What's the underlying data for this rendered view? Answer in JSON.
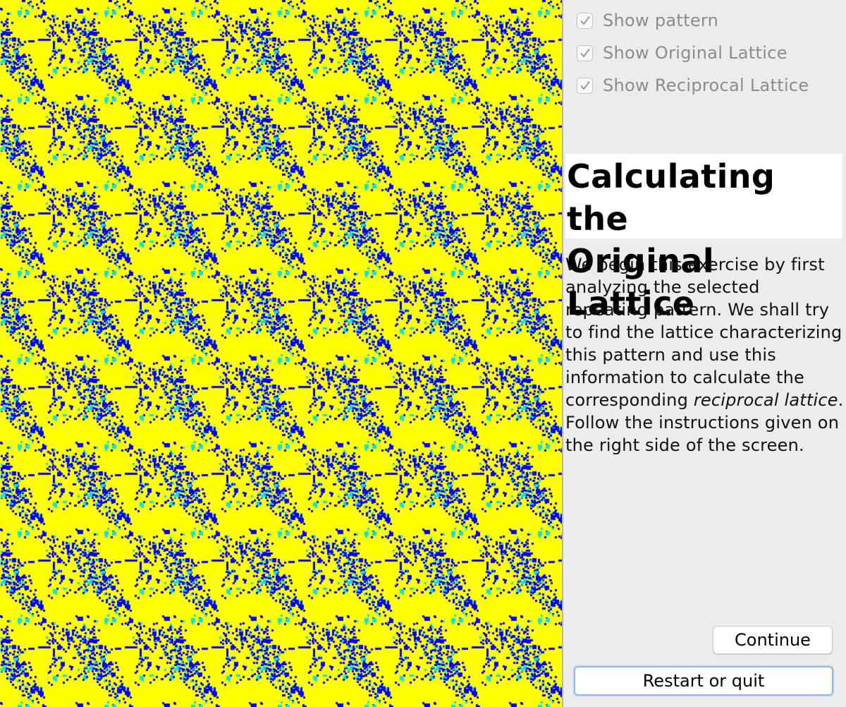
{
  "pattern": {
    "background_color": "#ffff00",
    "primary_dot_color": "#0000ff",
    "secondary_dot_color": "#00e5e5"
  },
  "options": [
    {
      "label": "Show pattern",
      "checked": true
    },
    {
      "label": "Show Original Lattice",
      "checked": true
    },
    {
      "label": "Show Reciprocal Lattice",
      "checked": true
    }
  ],
  "heading": {
    "line1": "Calculating the",
    "line2": "Original Lattice"
  },
  "description": {
    "before": "We begin this exercise by first analyzing the selected repeating pattern. We shall try to find the lattice characterizing this pattern and use this information to calculate the corresponding ",
    "emphasis": "reciprocal lattice",
    "after": ". Follow the instructions given on the right side of the screen."
  },
  "buttons": {
    "continue": "Continue",
    "restart": "Restart or quit"
  }
}
